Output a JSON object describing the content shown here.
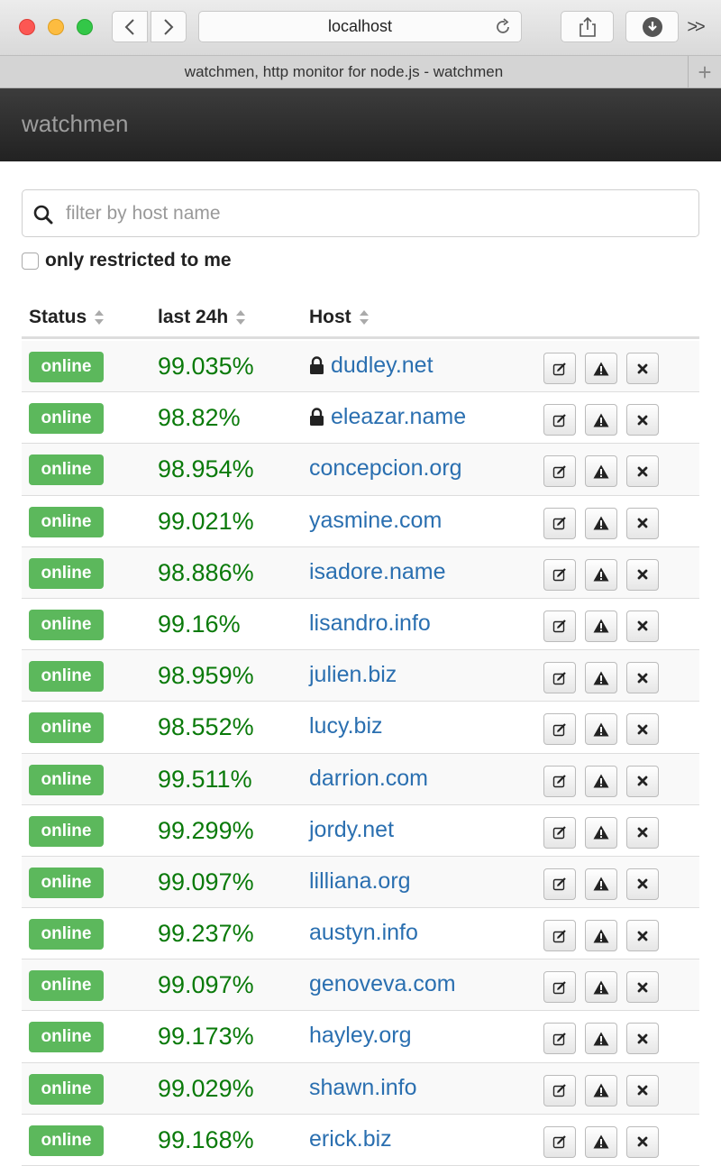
{
  "browser": {
    "address": "localhost",
    "tab_title": "watchmen, http monitor for node.js - watchmen",
    "new_tab": "+",
    "overflow": ">>"
  },
  "app": {
    "brand": "watchmen"
  },
  "filter": {
    "placeholder": "filter by host name",
    "value": ""
  },
  "restrict": {
    "label": "only restricted to me",
    "checked": false
  },
  "table": {
    "columns": [
      "Status",
      "last 24h",
      "Host"
    ],
    "rows": [
      {
        "status": "online",
        "uptime": "99.035%",
        "host": "dudley.net",
        "restricted": true
      },
      {
        "status": "online",
        "uptime": "98.82%",
        "host": "eleazar.name",
        "restricted": true
      },
      {
        "status": "online",
        "uptime": "98.954%",
        "host": "concepcion.org",
        "restricted": false
      },
      {
        "status": "online",
        "uptime": "99.021%",
        "host": "yasmine.com",
        "restricted": false
      },
      {
        "status": "online",
        "uptime": "98.886%",
        "host": "isadore.name",
        "restricted": false
      },
      {
        "status": "online",
        "uptime": "99.16%",
        "host": "lisandro.info",
        "restricted": false
      },
      {
        "status": "online",
        "uptime": "98.959%",
        "host": "julien.biz",
        "restricted": false
      },
      {
        "status": "online",
        "uptime": "98.552%",
        "host": "lucy.biz",
        "restricted": false
      },
      {
        "status": "online",
        "uptime": "99.511%",
        "host": "darrion.com",
        "restricted": false
      },
      {
        "status": "online",
        "uptime": "99.299%",
        "host": "jordy.net",
        "restricted": false
      },
      {
        "status": "online",
        "uptime": "99.097%",
        "host": "lilliana.org",
        "restricted": false
      },
      {
        "status": "online",
        "uptime": "99.237%",
        "host": "austyn.info",
        "restricted": false
      },
      {
        "status": "online",
        "uptime": "99.097%",
        "host": "genoveva.com",
        "restricted": false
      },
      {
        "status": "online",
        "uptime": "99.173%",
        "host": "hayley.org",
        "restricted": false
      },
      {
        "status": "online",
        "uptime": "99.029%",
        "host": "shawn.info",
        "restricted": false
      },
      {
        "status": "online",
        "uptime": "99.168%",
        "host": "erick.biz",
        "restricted": false
      }
    ]
  },
  "colors": {
    "online_badge": "#5cb85c",
    "uptime_text": "#0a7a0a",
    "host_link": "#2a6fb0",
    "appbar": "#222222"
  },
  "icons": {
    "edit": "edit-icon",
    "warning": "warning-icon",
    "delete": "close-icon",
    "lock": "lock-icon",
    "search": "search-icon"
  }
}
